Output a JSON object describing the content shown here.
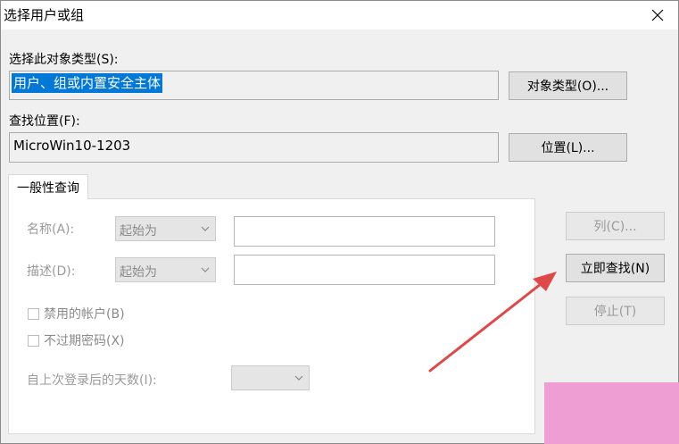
{
  "window": {
    "title": "选择用户或组"
  },
  "object_type": {
    "label": "选择此对象类型(S):",
    "value": "用户、组或内置安全主体",
    "button": "对象类型(O)..."
  },
  "location": {
    "label": "查找位置(F):",
    "value": "MicroWin10-1203",
    "button": "位置(L)..."
  },
  "tabs": [
    {
      "label": "一般性查询"
    }
  ],
  "query": {
    "name": {
      "label": "名称(A):",
      "mode": "起始为",
      "value": ""
    },
    "description": {
      "label": "描述(D):",
      "mode": "起始为",
      "value": ""
    },
    "disabled_accounts": {
      "label": "禁用的帐户(B)",
      "checked": false
    },
    "non_expiring_password": {
      "label": "不过期密码(X)",
      "checked": false
    },
    "days_since_logon": {
      "label": "自上次登录后的天数(I):",
      "value": ""
    }
  },
  "buttons": {
    "columns": "列(C)...",
    "find_now": "立即查找(N)",
    "stop": "停止(T)"
  },
  "colors": {
    "selection": "#0078d7",
    "annotation_arrow": "#e04848",
    "corner_overlay": "#ef9ed3"
  },
  "icons": {
    "close": "close-icon",
    "dropdown": "chevron-down-icon"
  }
}
